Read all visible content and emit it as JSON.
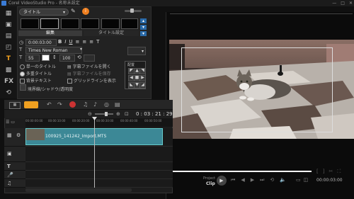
{
  "window": {
    "title": "Corel VideoStudio Pro - 名称未設定"
  },
  "options_panel": {
    "category": "タイトル",
    "tab_edit": "編集",
    "tab_title_settings": "タイトル設定",
    "timecode": "0:00:03:00",
    "font": "Times New Roman",
    "font_size": "55",
    "line_spacing": "100",
    "single_title": "単一のタイトル",
    "multiple_titles": "多重タイトル",
    "backdrop_text": "背景テキスト",
    "grid_lines": "グリッドラインを表示",
    "open_subtitle": "字幕ファイルを開く",
    "save_subtitle": "字幕ファイルを保存",
    "apply_shadow": "境界線/シャドウ/透明度",
    "alignment_label": "配置"
  },
  "preview": {
    "project_label": "Project",
    "clip_label": "Clip",
    "timecode": "00:00:03:00"
  },
  "timeline": {
    "time_display": "0 : 03 : 21 : 29",
    "ruler": [
      "00:00:00:00",
      "00:00:10:00",
      "00:00:20:00",
      "00:00:30:00",
      "00:00:40:00",
      "00:00:50:00"
    ],
    "clip_name": "100925_141242_Import.MTS"
  },
  "colors": {
    "clip": "#3c8896",
    "accent": "#f0a020"
  }
}
